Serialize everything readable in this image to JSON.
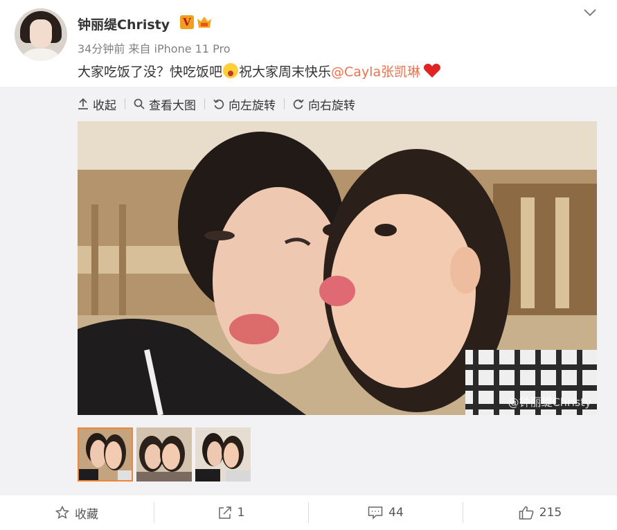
{
  "post": {
    "user_name": "钟丽缇Christy",
    "verified_badge": "V",
    "time": "34分钟前",
    "source": "来自 iPhone 11 Pro",
    "text_before": "大家吃饭了没？快吃饭吧",
    "text_after": "祝大家周末快乐",
    "mention": "@Cayla张凯琳"
  },
  "toolbar": {
    "collapse": "收起",
    "view_large": "查看大图",
    "rotate_left": "向左旋转",
    "rotate_right": "向右旋转"
  },
  "photo": {
    "watermark": "@钟丽缇Christy"
  },
  "actions": {
    "favorite": "收藏",
    "repost": "1",
    "comment": "44",
    "like": "215"
  },
  "colors": {
    "mention": "#eb7350",
    "thumb_active": "#f28333",
    "media_bg": "#f2f2f5"
  }
}
